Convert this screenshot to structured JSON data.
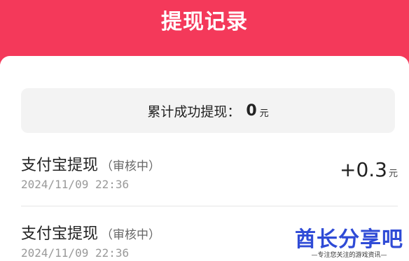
{
  "header": {
    "title": "提现记录"
  },
  "summary": {
    "label": "累计成功提现：",
    "amount": "0",
    "unit": "元"
  },
  "records": [
    {
      "title": "支付宝提现",
      "status": "（审核中）",
      "time": "2024/11/09 22:36",
      "amount": "+0.3",
      "unit": "元"
    },
    {
      "title": "支付宝提现",
      "status": "（审核中）",
      "time": "2024/11/09 22:36",
      "amount": "",
      "unit": ""
    }
  ],
  "watermark": {
    "main": "酋长分享吧",
    "sub": "—专注您关注的游戏资讯—"
  },
  "colors": {
    "header_bg": "#f4395a",
    "watermark": "#2f4bd6"
  }
}
